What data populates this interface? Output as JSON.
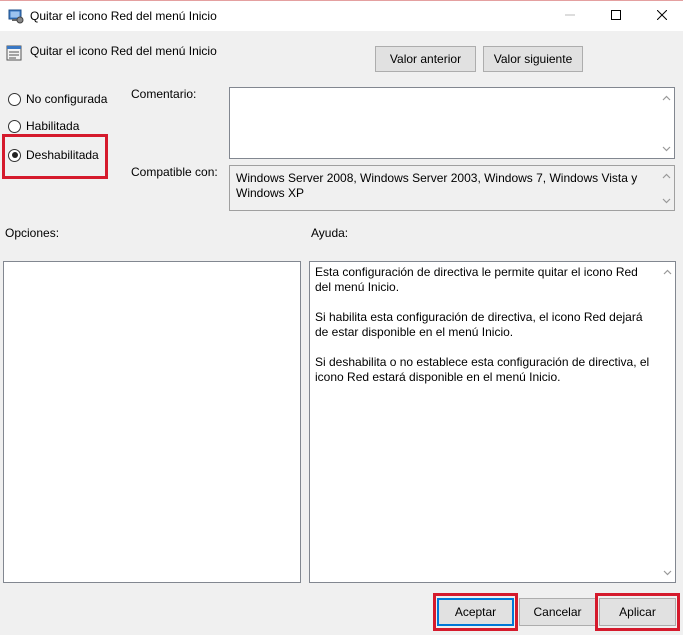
{
  "window": {
    "title": "Quitar el icono Red del menú Inicio",
    "icons": [
      "app-settings-icon",
      "minimize-icon",
      "maximize-icon",
      "close-icon"
    ]
  },
  "policy": {
    "name": "Quitar el icono Red del menú Inicio",
    "icon": "policy-setting-icon"
  },
  "nav": {
    "prev_label": "Valor anterior",
    "next_label": "Valor siguiente"
  },
  "state": {
    "options": [
      {
        "label": "No configurada",
        "checked": false
      },
      {
        "label": "Habilitada",
        "checked": false
      },
      {
        "label": "Deshabilitada",
        "checked": true
      }
    ]
  },
  "comment": {
    "label": "Comentario:",
    "value": ""
  },
  "compatible": {
    "label": "Compatible con:",
    "value": "Windows Server 2008, Windows Server 2003, Windows 7, Windows Vista y Windows XP"
  },
  "options_panel": {
    "label": "Opciones:"
  },
  "help_panel": {
    "label": "Ayuda:",
    "paragraphs": [
      "Esta configuración de directiva le permite quitar el icono Red del menú Inicio.",
      "Si habilita esta configuración de directiva, el icono Red dejará de estar disponible en el menú Inicio.",
      "Si deshabilita o no establece esta configuración de directiva, el icono Red estará disponible en el menú Inicio."
    ]
  },
  "footer": {
    "ok_label": "Aceptar",
    "cancel_label": "Cancelar",
    "apply_label": "Aplicar"
  },
  "colors": {
    "highlight": "#d51a2c",
    "default_button_border": "#0078d7",
    "window_bg": "#f0f0f0"
  }
}
